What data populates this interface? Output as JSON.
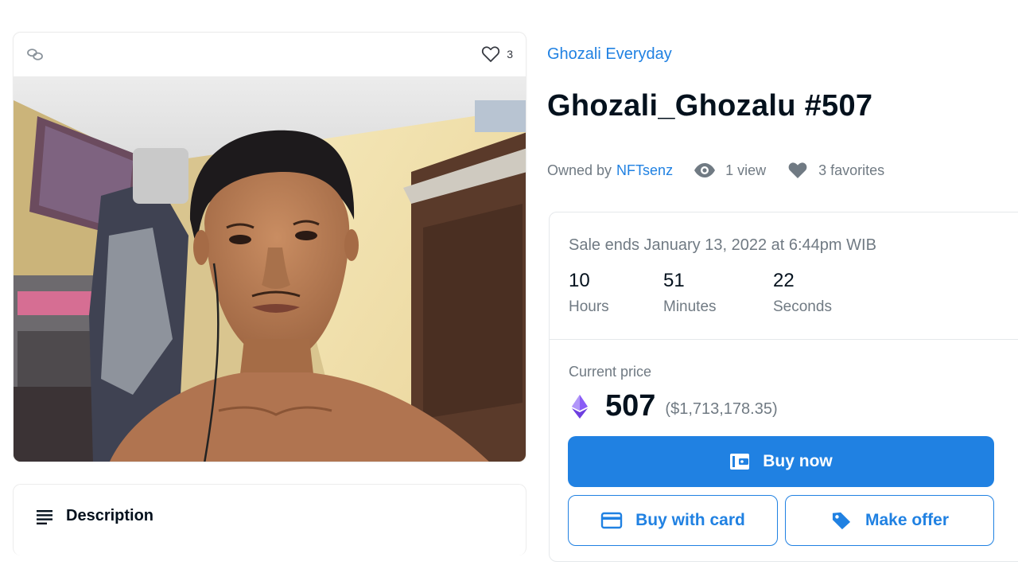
{
  "media": {
    "favorite_count": "3",
    "photo_alt": "Ghozali_Ghozalu #507"
  },
  "description": {
    "label": "Description"
  },
  "item": {
    "collection": "Ghozali Everyday",
    "title": "Ghozali_Ghozalu #507",
    "owned_by_label": "Owned by",
    "owner": "NFTsenz",
    "views": "1 view",
    "favorites": "3 favorites"
  },
  "sale": {
    "ends_text": "Sale ends January 13, 2022 at 6:44pm WIB",
    "countdown": [
      {
        "value": "10",
        "label": "Hours"
      },
      {
        "value": "51",
        "label": "Minutes"
      },
      {
        "value": "22",
        "label": "Seconds"
      }
    ]
  },
  "price": {
    "label": "Current price",
    "value": "507",
    "usd": "($1,713,178.35)"
  },
  "buttons": {
    "buy_now": "Buy now",
    "buy_with_card": "Buy with card",
    "make_offer": "Make offer"
  },
  "colors": {
    "accent": "#2081e2",
    "muted_text": "#707a83",
    "eth_purple": "#8a5cf6"
  },
  "icons": [
    "link-icon",
    "heart-outline-icon",
    "description-lines-icon",
    "eye-icon",
    "heart-filled-icon",
    "ethereum-icon",
    "wallet-icon",
    "credit-card-icon",
    "tag-icon"
  ]
}
